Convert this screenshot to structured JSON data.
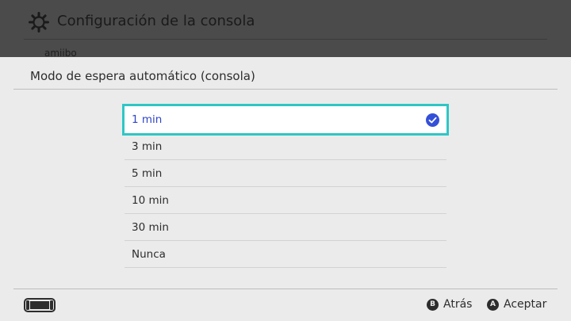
{
  "background": {
    "title": "Configuración de la consola",
    "subitem": "amiibo",
    "icon": "gear-icon"
  },
  "dialog": {
    "title": "Modo de espera automático (consola)",
    "options": [
      {
        "label": "1 min",
        "selected": true
      },
      {
        "label": "3 min",
        "selected": false
      },
      {
        "label": "5 min",
        "selected": false
      },
      {
        "label": "10 min",
        "selected": false
      },
      {
        "label": "30 min",
        "selected": false
      },
      {
        "label": "Nunca",
        "selected": false
      }
    ],
    "selected_icon": "checkmark-icon"
  },
  "footer": {
    "console_icon": "console-icon",
    "back": {
      "glyph": "B",
      "label": "Atrás"
    },
    "accept": {
      "glyph": "A",
      "label": "Aceptar"
    }
  },
  "colors": {
    "accent_outline": "#2fc6c6",
    "selected_text": "#2f45c8",
    "check_fill": "#3550d8"
  }
}
